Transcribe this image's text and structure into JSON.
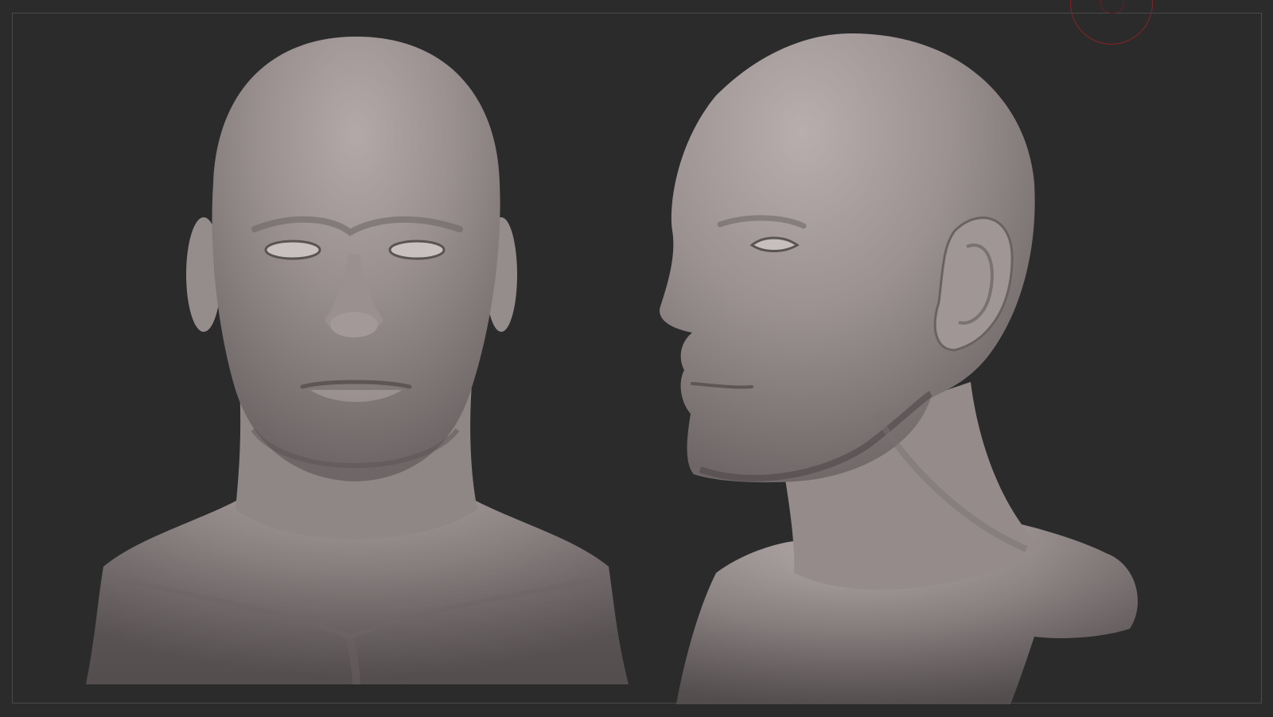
{
  "viewport": {
    "background_color": "#2b2b2c",
    "frame_color": "#4a4a4b"
  },
  "gizmo": {
    "color": "#8a2222",
    "icon": "navigation-gizmo-icon"
  },
  "models": [
    {
      "name": "head-bust-front-view",
      "material_color": "#8e8585"
    },
    {
      "name": "head-bust-side-view",
      "material_color": "#8e8585"
    }
  ]
}
